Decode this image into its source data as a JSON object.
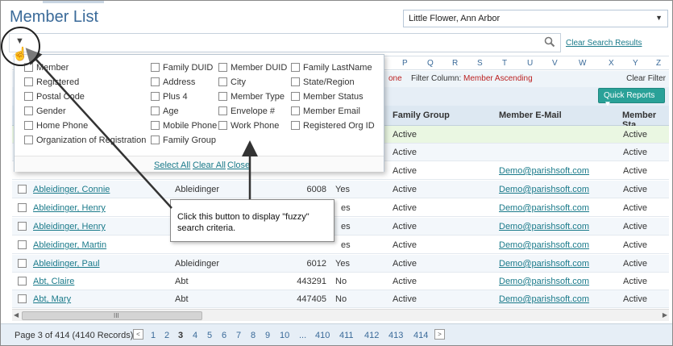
{
  "page": {
    "title": "Member List"
  },
  "parish_selector": {
    "value": "Little Flower, Ann Arbor"
  },
  "search": {
    "clear_label": "Clear Search Results"
  },
  "alphabet": [
    "P",
    "Q",
    "R",
    "S",
    "T",
    "U",
    "V",
    "W",
    "X",
    "Y",
    "Z"
  ],
  "filter": {
    "left_fragment": "one",
    "label": "Filter Column:",
    "value": "Member Ascending",
    "clear_label": "Clear Filter"
  },
  "quick_reports": {
    "label": "Quick Reports ▼"
  },
  "columns": {
    "family_group": "Family Group",
    "member_email": "Member E-Mail",
    "member_status": "Member Sta"
  },
  "rows": [
    {
      "name": "",
      "family": "",
      "duid": "",
      "flag": "",
      "group": "Active",
      "email": "",
      "status": "Active"
    },
    {
      "name": "",
      "family": "",
      "duid": "",
      "flag": "",
      "group": "Active",
      "email": "",
      "status": "Active"
    },
    {
      "name": "",
      "family": "",
      "duid": "",
      "flag": "",
      "group": "Active",
      "email": "Demo@parishsoft.com",
      "status": "Active"
    },
    {
      "name": "Ableidinger, Connie",
      "family": "Ableidinger",
      "duid": "6008",
      "flag": "Yes",
      "group": "Active",
      "email": "Demo@parishsoft.com",
      "status": "Active"
    },
    {
      "name": "Ableidinger, Henry",
      "family": "",
      "duid": "",
      "flag": "es",
      "group": "Active",
      "email": "Demo@parishsoft.com",
      "status": "Active"
    },
    {
      "name": "Ableidinger, Henry",
      "family": "",
      "duid": "",
      "flag": "es",
      "group": "Active",
      "email": "Demo@parishsoft.com",
      "status": "Active"
    },
    {
      "name": "Ableidinger, Martin",
      "family": "",
      "duid": "",
      "flag": "es",
      "group": "Active",
      "email": "Demo@parishsoft.com",
      "status": "Active"
    },
    {
      "name": "Ableidinger, Paul",
      "family": "Ableidinger",
      "duid": "6012",
      "flag": "Yes",
      "group": "Active",
      "email": "Demo@parishsoft.com",
      "status": "Active"
    },
    {
      "name": "Abt, Claire",
      "family": "Abt",
      "duid": "443291",
      "flag": "No",
      "group": "Active",
      "email": "Demo@parishsoft.com",
      "status": "Active"
    },
    {
      "name": "Abt, Mary",
      "family": "Abt",
      "duid": "447405",
      "flag": "No",
      "group": "Active",
      "email": "Demo@parishsoft.com",
      "status": "Active"
    }
  ],
  "scrollbar": {
    "grip": "III"
  },
  "pager": {
    "info": "Page 3 of 414 (4140 Records)",
    "pages": [
      "1",
      "2",
      "3",
      "4",
      "5",
      "6",
      "7",
      "8",
      "9",
      "10",
      "...",
      "410",
      "411",
      "412",
      "413",
      "414"
    ],
    "current": "3"
  },
  "fuzzy_options": [
    "Member",
    "Registered",
    "Postal Code",
    "Gender",
    "Home Phone",
    "Organization of Registration",
    "Family DUID",
    "Address",
    "Plus 4",
    "Age",
    "Mobile Phone",
    "Family Group",
    "Member DUID",
    "City",
    "Member Type",
    "Envelope #",
    "Work Phone",
    "Family LastName",
    "State/Region",
    "Member Status",
    "Member Email",
    "Registered Org ID"
  ],
  "popup_footer": {
    "select_all": "Select All",
    "clear_all": "Clear All",
    "close": "Close"
  },
  "callout": {
    "text": "Click this button to display \"fuzzy\" search criteria."
  },
  "colors": {
    "title": "#3a6a99",
    "link": "#1a7a8a",
    "button": "#2aa198",
    "highlight_row": "#eaf7e2"
  }
}
